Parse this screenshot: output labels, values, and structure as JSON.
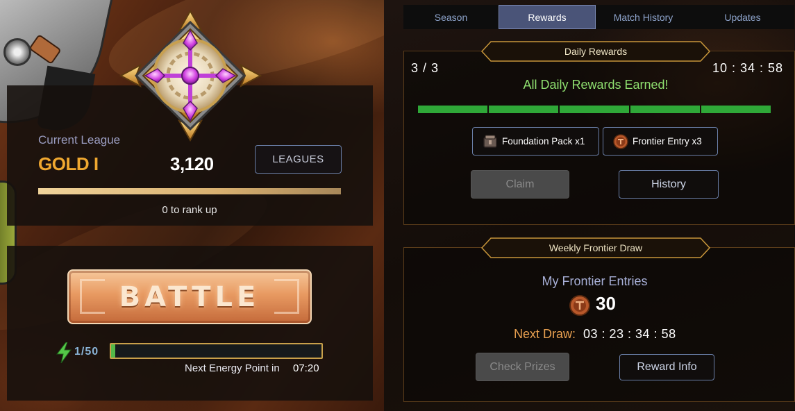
{
  "league": {
    "current_label": "Current League",
    "tier": "GOLD I",
    "points": "3,120",
    "leagues_button": "LEAGUES",
    "rank_progress": 1.0,
    "rank_up_text": "0 to rank up"
  },
  "battle": {
    "button_label": "BATTLE",
    "energy_count": "1/50",
    "energy_fraction": 0.02,
    "next_energy_label": "Next Energy Point in",
    "next_energy_time": "07:20"
  },
  "tabs": [
    {
      "label": "Season"
    },
    {
      "label": "Rewards",
      "active": true
    },
    {
      "label": "Match History"
    },
    {
      "label": "Updates"
    }
  ],
  "daily": {
    "title": "Daily Rewards",
    "count": "3 / 3",
    "timer": "10 : 34 : 58",
    "status": "All Daily Rewards Earned!",
    "segments_filled": 5,
    "rewards": [
      {
        "label": "Foundation Pack x1",
        "icon": "foundation-pack-icon"
      },
      {
        "label": "Frontier Entry x3",
        "icon": "frontier-entry-icon"
      }
    ],
    "claim_label": "Claim",
    "history_label": "History"
  },
  "weekly": {
    "title": "Weekly Frontier Draw",
    "entries_label": "My Frontier Entries",
    "entries_count": "30",
    "next_draw_label": "Next Draw:",
    "next_draw_time": "03 : 23 : 34 : 58",
    "check_prizes_label": "Check Prizes",
    "reward_info_label": "Reward Info"
  },
  "colors": {
    "gold": "#f0a830",
    "green": "#2fa838",
    "accent_blue": "#4a5478",
    "energy_green": "#54b848",
    "next_draw_orange": "#e8a050"
  }
}
